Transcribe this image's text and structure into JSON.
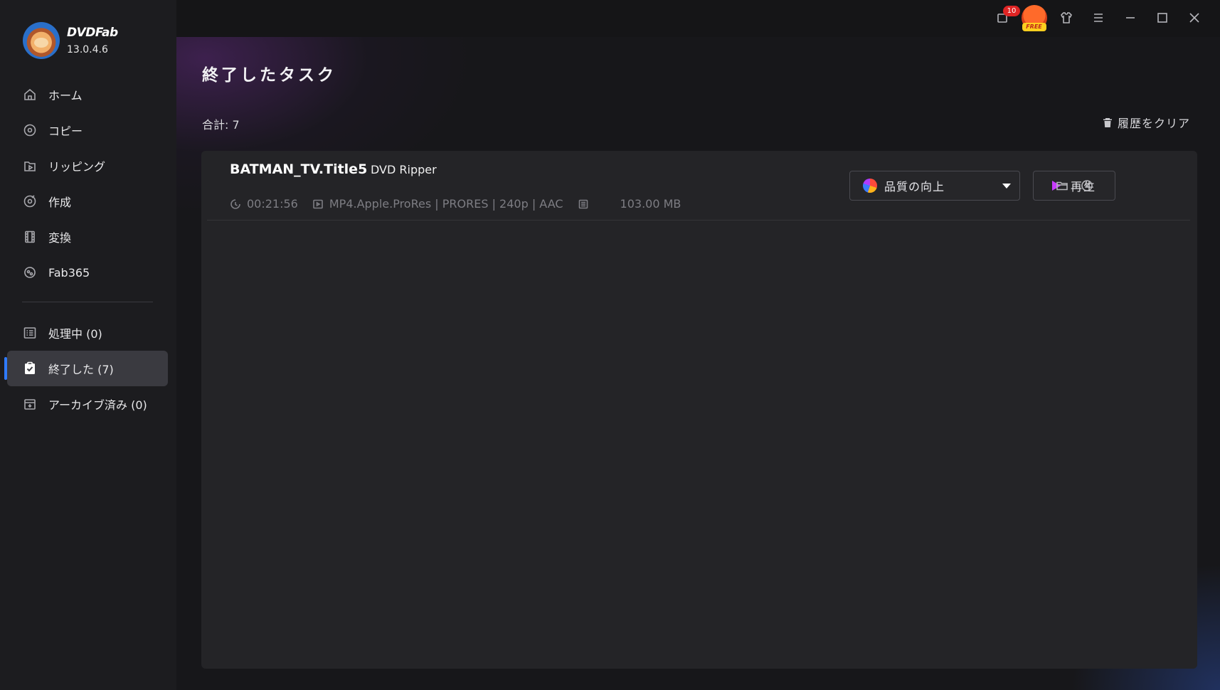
{
  "app": {
    "name": "DVDFab",
    "version": "13.0.4.6"
  },
  "titlebar": {
    "notification_count": "10",
    "free_badge": "FREE"
  },
  "sidebar": {
    "primary": [
      {
        "label": "ホーム",
        "icon": "home-icon"
      },
      {
        "label": "コピー",
        "icon": "copy-icon"
      },
      {
        "label": "リッピング",
        "icon": "ripper-icon"
      },
      {
        "label": "作成",
        "icon": "creator-icon"
      },
      {
        "label": "変換",
        "icon": "film-icon"
      },
      {
        "label": "Fab365",
        "icon": "fab365-icon"
      }
    ],
    "tasks": [
      {
        "label": "処理中 (0)",
        "icon": "processing-list-icon"
      },
      {
        "label": "終了した (7)",
        "icon": "finished-clipboard-icon",
        "active": true
      },
      {
        "label": "アーカイブ済み (0)",
        "icon": "archive-box-icon"
      }
    ]
  },
  "main": {
    "title": "終了したタスク",
    "total": "合計: 7",
    "clear_history": "履歴をクリア",
    "task": {
      "name": "BATMAN_TV.Title5",
      "type": "DVD Ripper",
      "duration": "00:21:56",
      "profile": "MP4.Apple.ProRes | PRORES | 240p | AAC",
      "size": "103.00 MB",
      "enhance_label": "品質の向上",
      "play_label": "再生"
    }
  },
  "colors": {
    "accent": "#2f7bff",
    "badge": "#e02424",
    "sidebar_bg": "#1c1c1f",
    "panel_bg": "#242427"
  }
}
